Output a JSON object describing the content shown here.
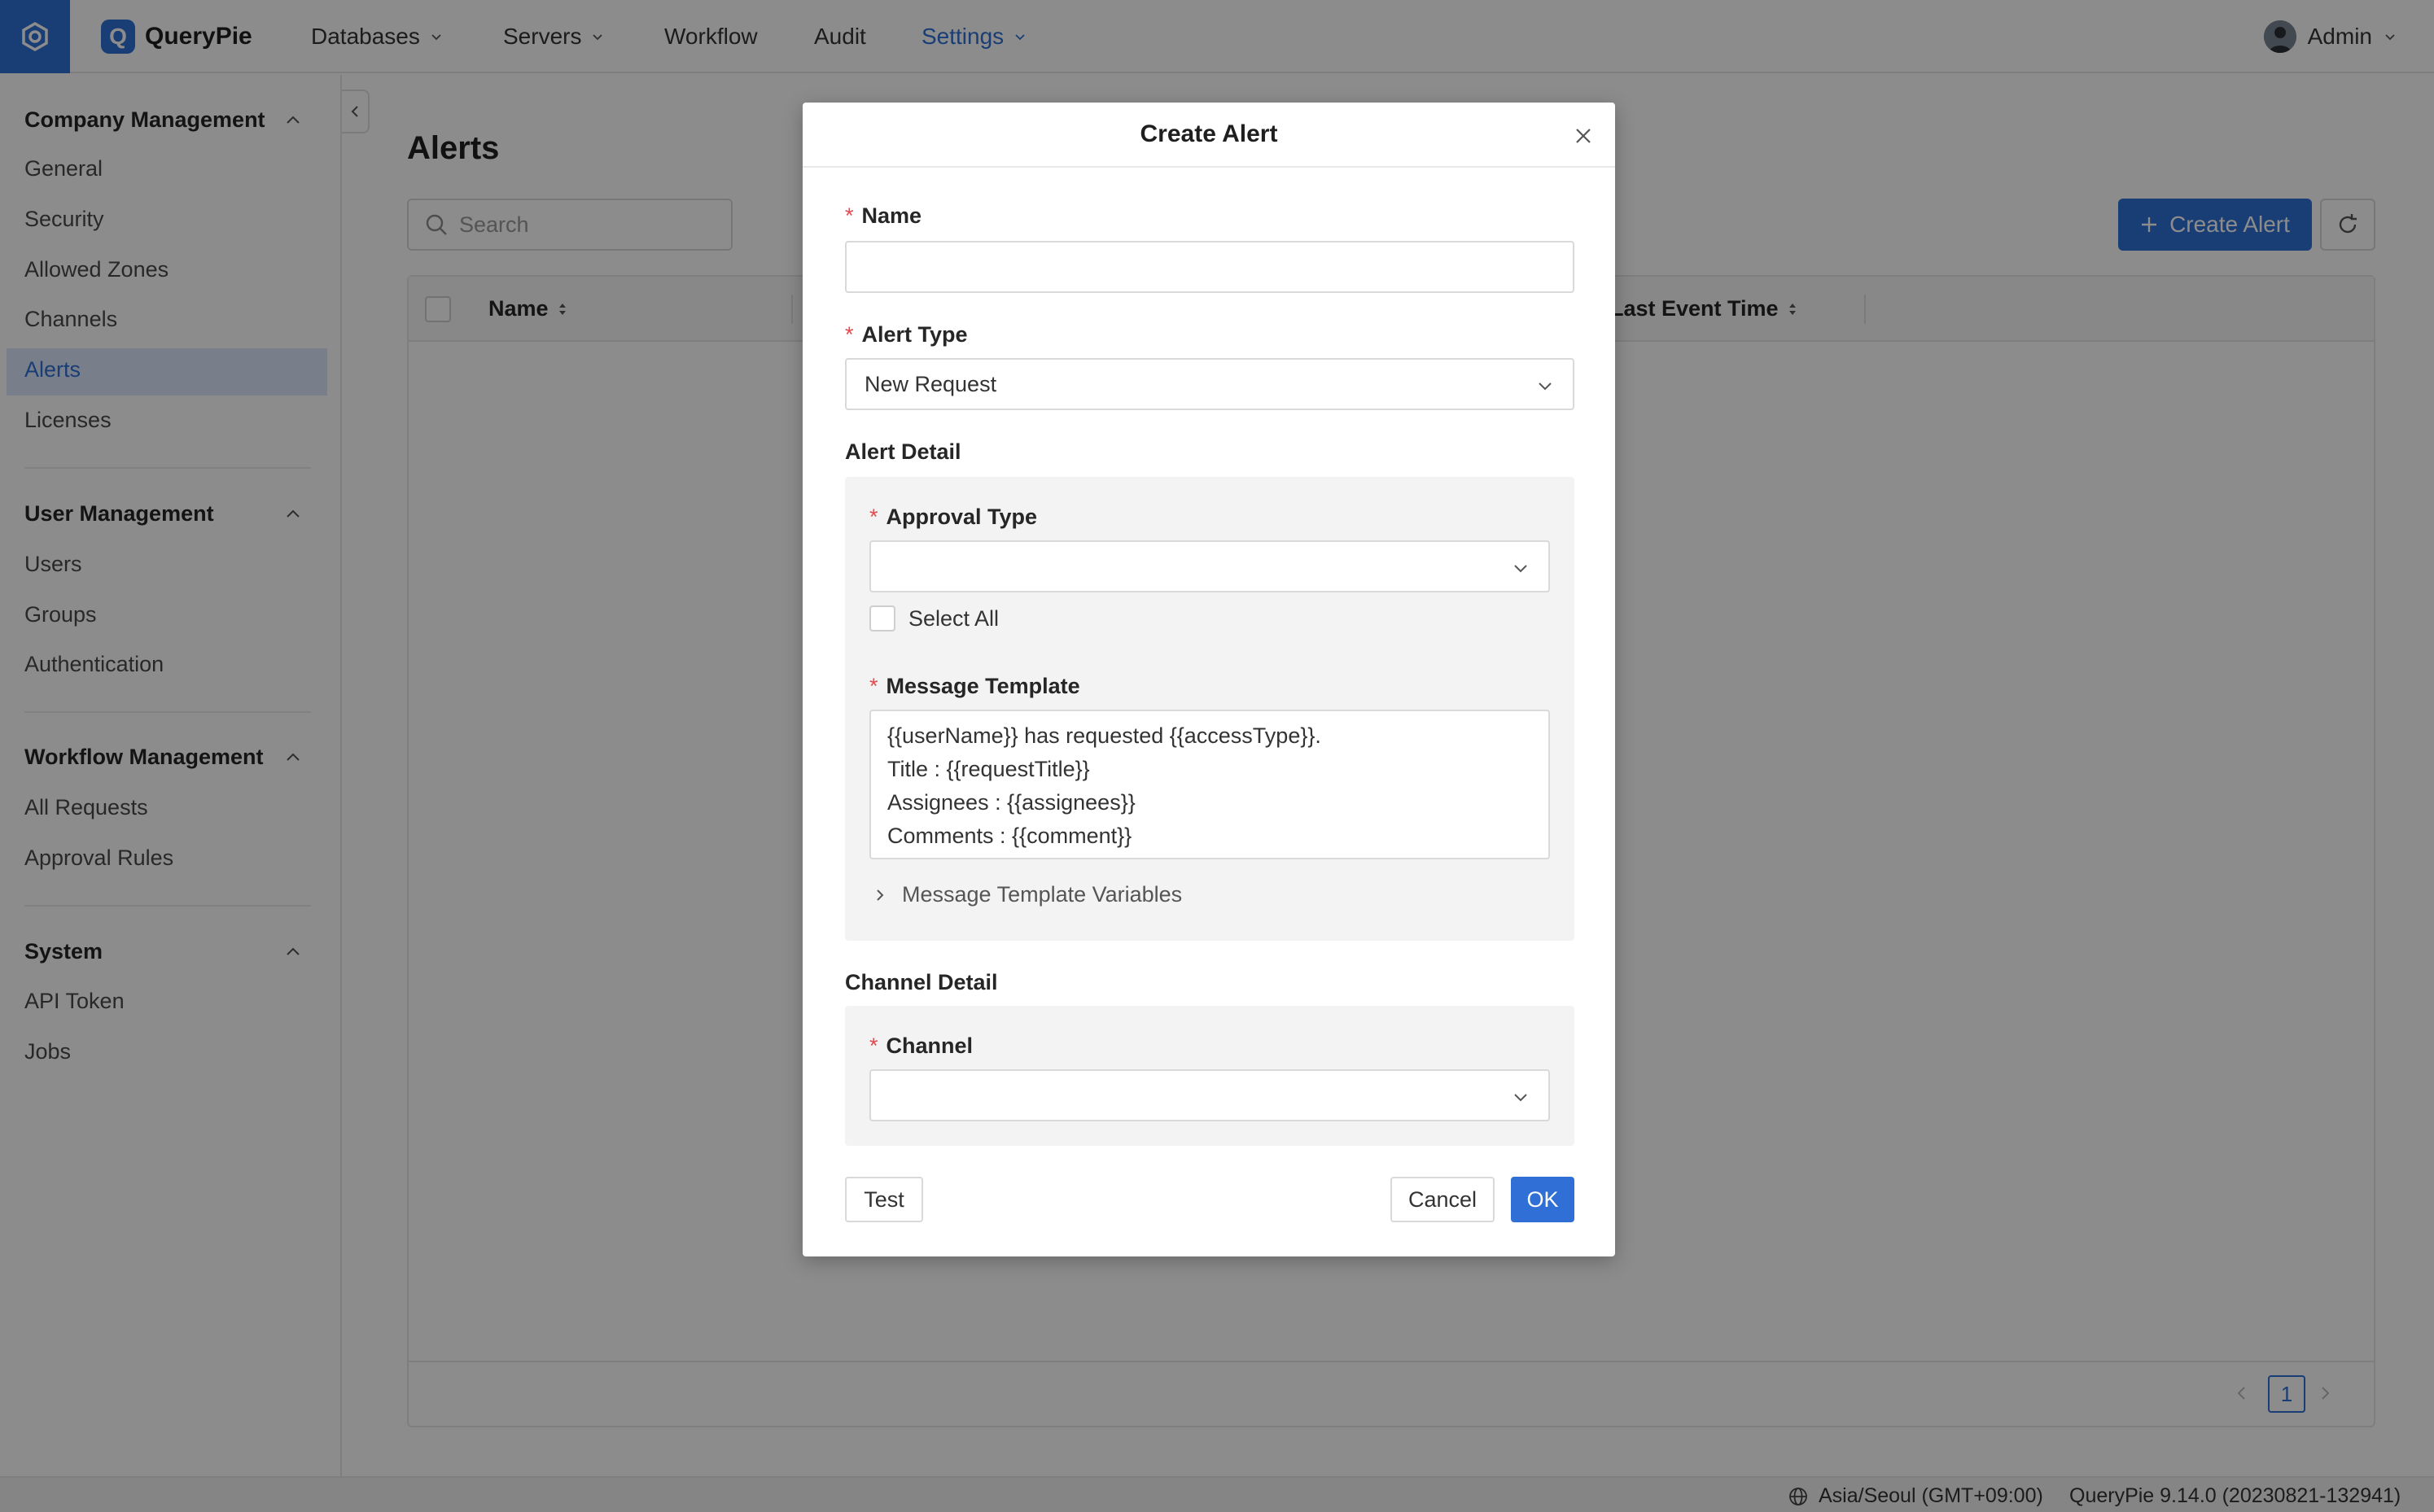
{
  "app": {
    "brand": "QueryPie",
    "brand_badge": "Q"
  },
  "nav": {
    "items": [
      {
        "label": "Databases",
        "has_dropdown": true
      },
      {
        "label": "Servers",
        "has_dropdown": true
      },
      {
        "label": "Workflow",
        "has_dropdown": false
      },
      {
        "label": "Audit",
        "has_dropdown": false
      },
      {
        "label": "Settings",
        "has_dropdown": true,
        "active": true
      }
    ],
    "user": "Admin"
  },
  "sidebar": {
    "groups": [
      {
        "title": "Company Management",
        "items": [
          "General",
          "Security",
          "Allowed Zones",
          "Channels",
          "Alerts",
          "Licenses"
        ],
        "active": "Alerts"
      },
      {
        "title": "User Management",
        "items": [
          "Users",
          "Groups",
          "Authentication"
        ]
      },
      {
        "title": "Workflow Management",
        "items": [
          "All Requests",
          "Approval Rules"
        ]
      },
      {
        "title": "System",
        "items": [
          "API Token",
          "Jobs"
        ]
      }
    ]
  },
  "main": {
    "title": "Alerts",
    "search_placeholder": "Search",
    "create_button": "Create Alert",
    "columns": [
      "Name",
      "Last Event Time"
    ],
    "page": "1"
  },
  "modal": {
    "title": "Create Alert",
    "name_label": "Name",
    "name_value": "",
    "alert_type_label": "Alert Type",
    "alert_type_value": "New Request",
    "alert_detail_title": "Alert Detail",
    "approval_type_label": "Approval Type",
    "approval_type_value": "",
    "select_all_label": "Select All",
    "message_template_label": "Message Template",
    "message_template_lines": [
      "{{userName}} has requested {{accessType}}.",
      "Title : {{requestTitle}}",
      "Assignees : {{assignees}}",
      "Comments : {{comment}}"
    ],
    "template_variables_label": "Message Template Variables",
    "channel_detail_title": "Channel Detail",
    "channel_label": "Channel",
    "channel_value": "",
    "test_button": "Test",
    "cancel_button": "Cancel",
    "ok_button": "OK"
  },
  "footer": {
    "timezone": "Asia/Seoul (GMT+09:00)",
    "version": "QueryPie 9.14.0 (20230821-132941)"
  },
  "colors": {
    "accent": "#2f6fd6",
    "required": "#e5484d",
    "active_sidebar_bg": "#dce8fb"
  }
}
